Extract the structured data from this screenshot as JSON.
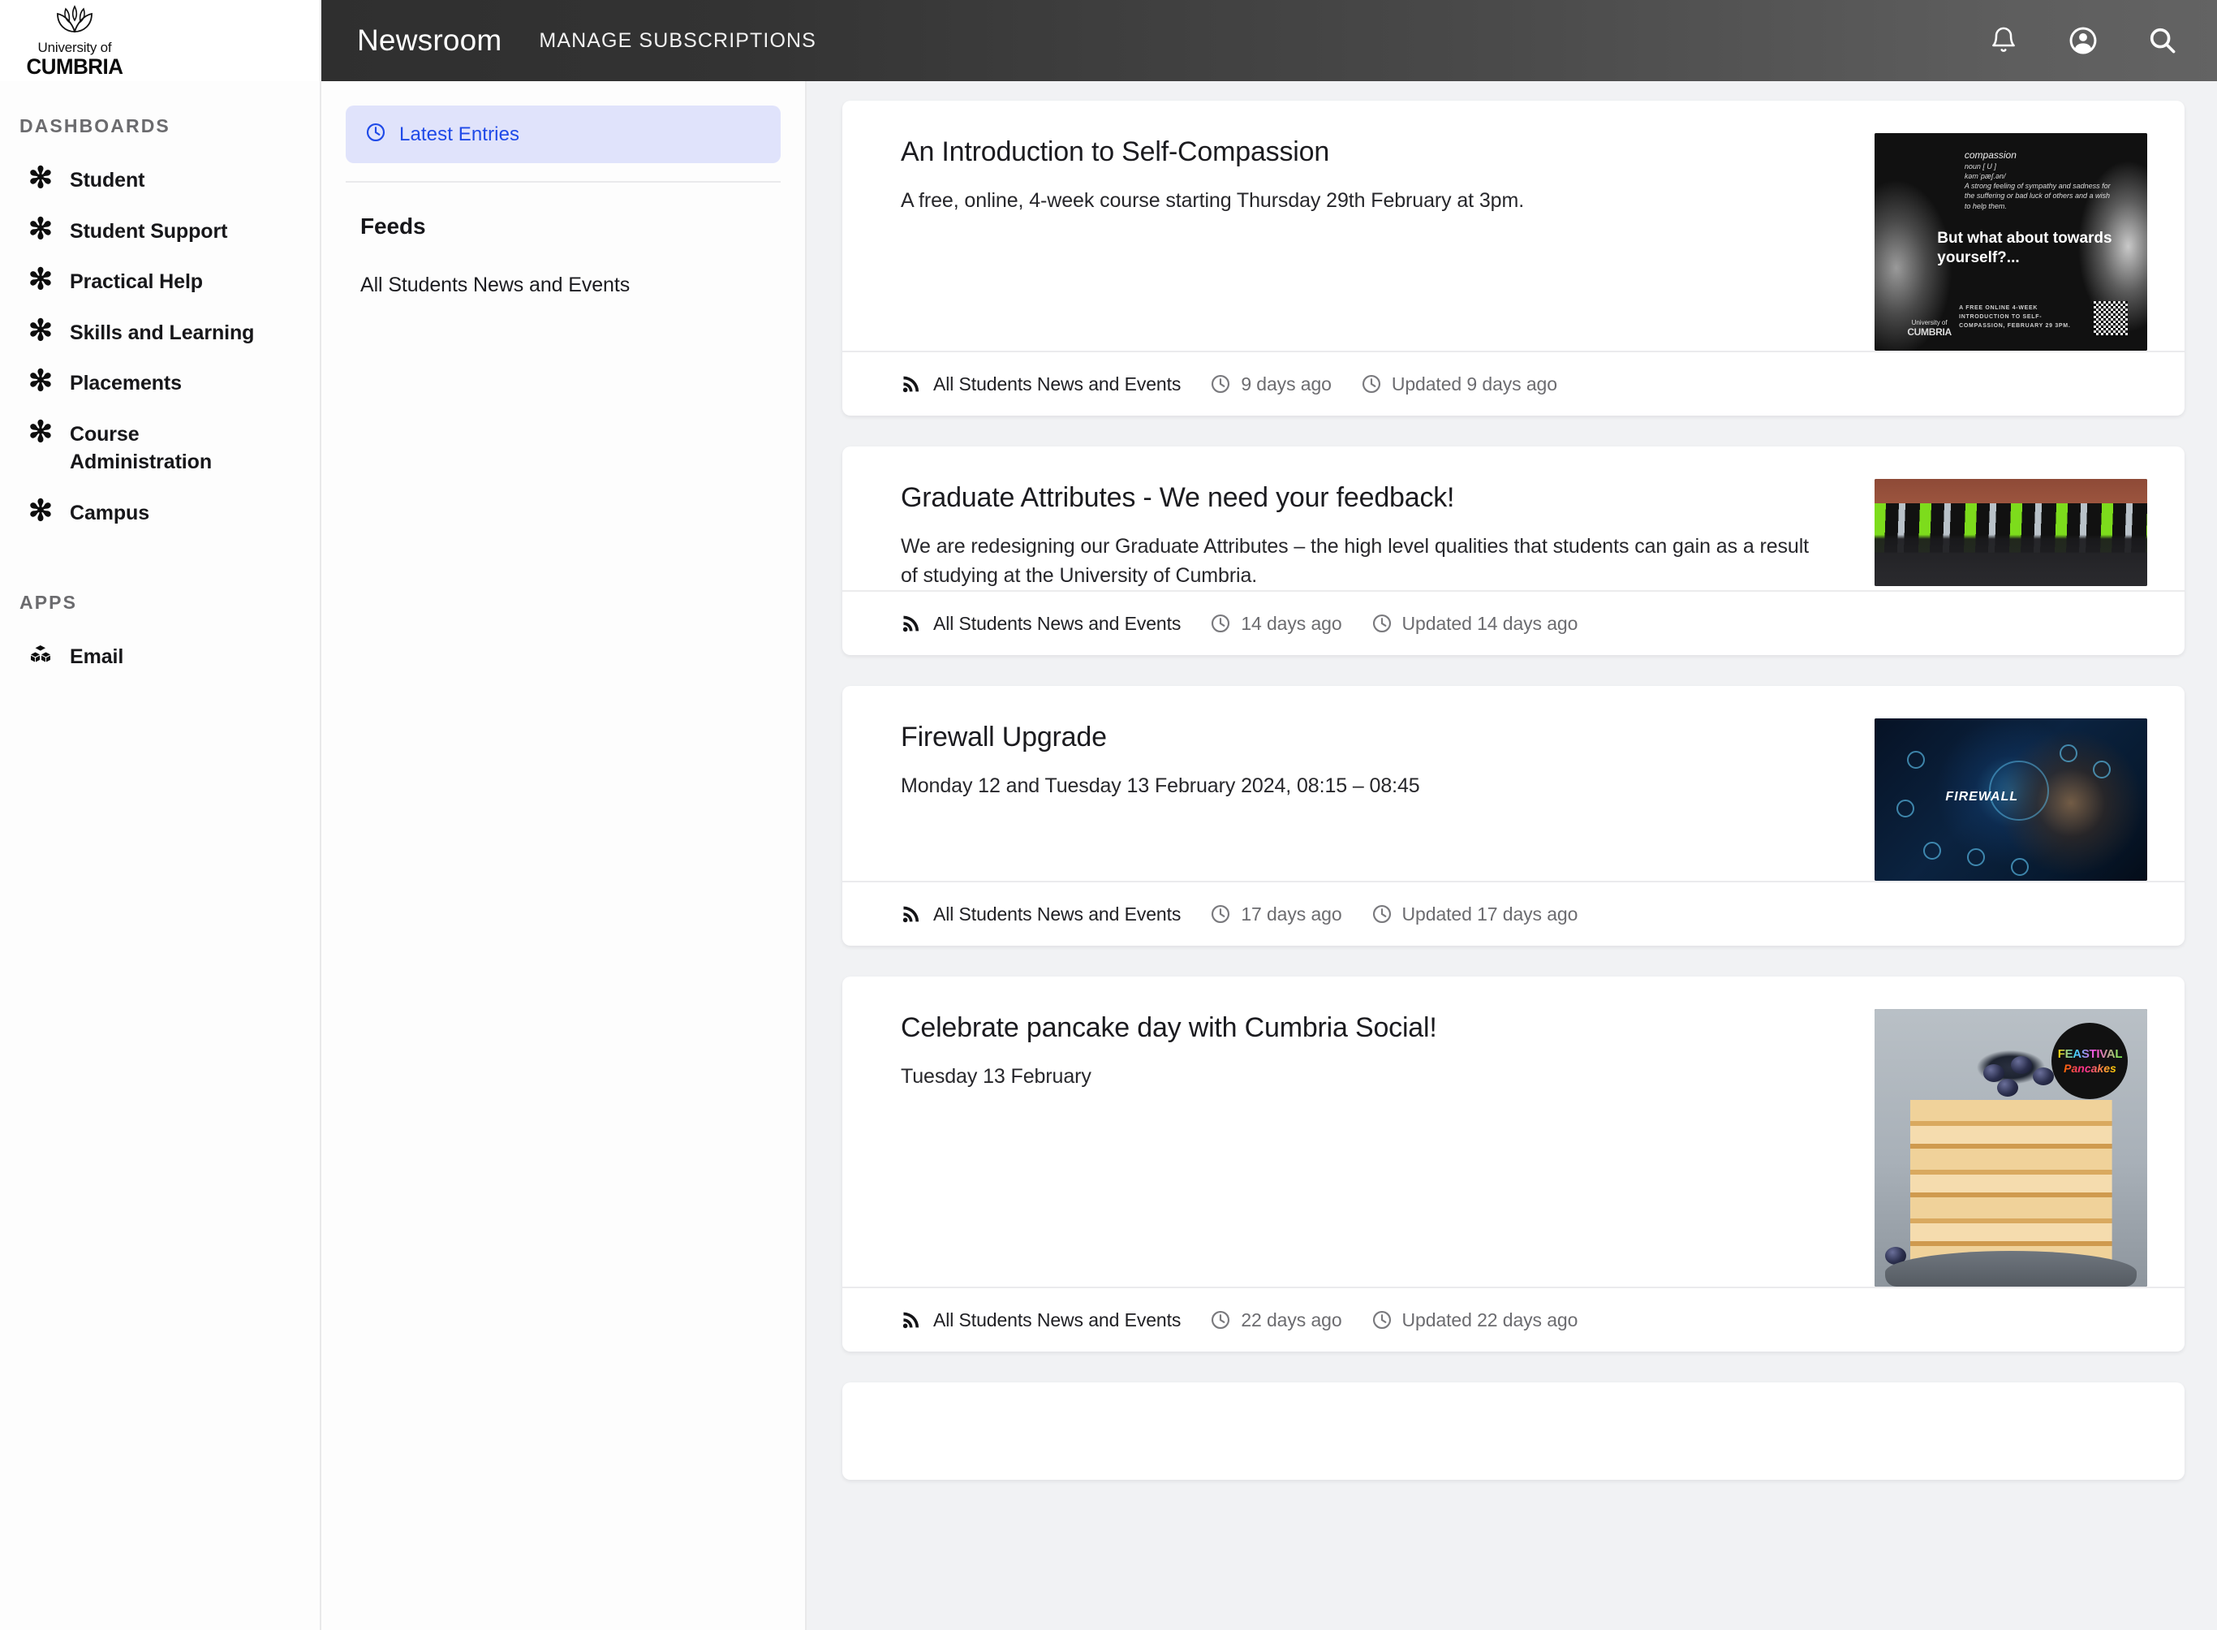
{
  "sidebar": {
    "logo": {
      "icon": "cumbria-leaf-logo",
      "line1": "University of",
      "line2": "CUMBRIA"
    },
    "sections": [
      {
        "title": "DASHBOARDS",
        "items": [
          {
            "label": "Student",
            "icon": "asterisk-icon"
          },
          {
            "label": "Student Support",
            "icon": "asterisk-icon"
          },
          {
            "label": "Practical Help",
            "icon": "asterisk-icon"
          },
          {
            "label": "Skills and Learning",
            "icon": "asterisk-icon"
          },
          {
            "label": "Placements",
            "icon": "asterisk-icon"
          },
          {
            "label": "Course Administration",
            "icon": "asterisk-icon"
          },
          {
            "label": "Campus",
            "icon": "asterisk-icon"
          }
        ]
      },
      {
        "title": "APPS",
        "items": [
          {
            "label": "Email",
            "icon": "cubes-icon"
          }
        ]
      }
    ]
  },
  "topbar": {
    "brand": "Newsroom",
    "nav": [
      {
        "label": "MANAGE SUBSCRIPTIONS"
      }
    ],
    "icons": [
      {
        "name": "notifications-bell-icon"
      },
      {
        "name": "user-account-icon"
      },
      {
        "name": "search-icon"
      }
    ]
  },
  "feeds_panel": {
    "latest_entries": {
      "label": "Latest Entries",
      "icon": "clock-icon"
    },
    "heading": "Feeds",
    "items": [
      {
        "label": "All Students News and Events"
      }
    ]
  },
  "articles": [
    {
      "title": "An Introduction to Self-Compassion",
      "description": "A free, online, 4-week course starting Thursday 29th February at 3pm.",
      "feed": "All Students News and Events",
      "published": "9 days ago",
      "updated": "Updated 9 days ago",
      "thumbnail": {
        "name": "self-compassion-poster",
        "def_word": "compassion",
        "def_pos": "noun [ U ]",
        "def_phon": "kəmˈpæʃ.ən/",
        "def_text": "A strong feeling of sympathy and sadness for the suffering or bad luck of others and a wish to help them.",
        "headline": "But what about towards yourself?...",
        "logo_line1": "University of",
        "logo_line2": "CUMBRIA",
        "footer": "A FREE ONLINE 4-WEEK INTRODUCTION TO SELF-COMPASSION, FEBRUARY 29 3PM."
      }
    },
    {
      "title": "Graduate Attributes - We need your feedback!",
      "description": "We are redesigning our Graduate Attributes – the high level qualities that students can gain as a result of studying at the University of Cumbria.",
      "feed": "All Students News and Events",
      "published": "14 days ago",
      "updated": "Updated 14 days ago",
      "thumbnail": {
        "name": "graduation-procession-photo"
      }
    },
    {
      "title": "Firewall Upgrade",
      "description": "Monday 12 and Tuesday 13 February 2024, 08:15 – 08:45",
      "feed": "All Students News and Events",
      "published": "17 days ago",
      "updated": "Updated 17 days ago",
      "thumbnail": {
        "name": "firewall-network-photo",
        "word": "FIREWALL"
      }
    },
    {
      "title": "Celebrate pancake day with Cumbria Social!",
      "description": "Tuesday 13 February",
      "feed": "All Students News and Events",
      "published": "22 days ago",
      "updated": "Updated 22 days ago",
      "thumbnail": {
        "name": "pancake-stack-photo",
        "badge_line1": "FEASTIVAL",
        "badge_line2": "Pancakes"
      }
    }
  ],
  "colors": {
    "accent_blue": "#1f4ae8",
    "latest_entries_bg": "#e0e3fb",
    "topbar_dark": "#2f2f2f",
    "stream_bg": "#f1f2f4"
  }
}
